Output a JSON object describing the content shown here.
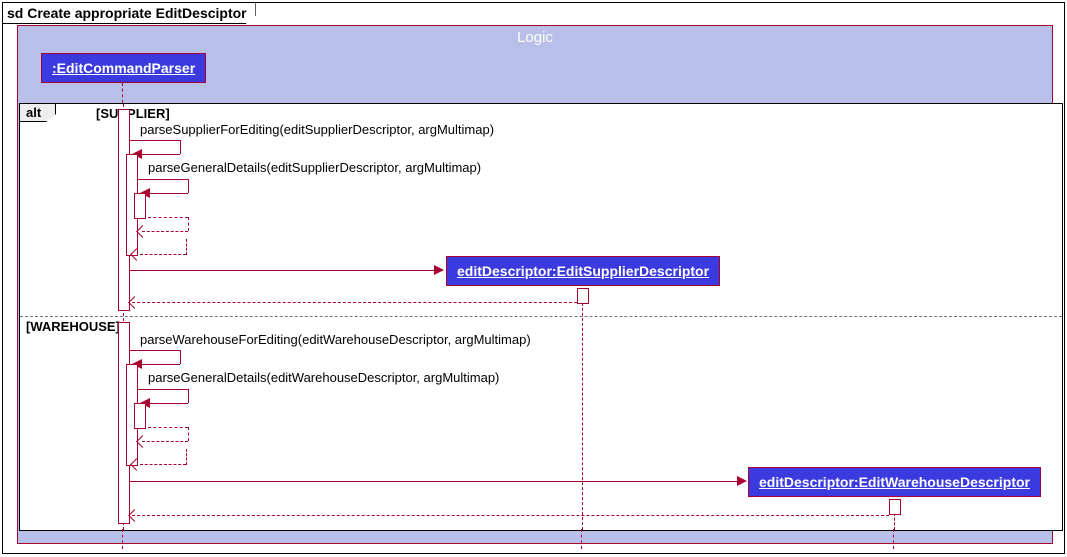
{
  "frame_title": "sd Create appropriate EditDesciptor",
  "logic_title": "Logic",
  "alt_label": "alt",
  "guard_supplier": "[SUPPLIER]",
  "guard_warehouse": "[WAREHOUSE]",
  "parser_header": ":EditCommandParser",
  "supplier_descriptor_header": "editDescriptor:EditSupplierDescriptor",
  "warehouse_descriptor_header": "editDescriptor:EditWarehouseDescriptor",
  "msg_parse_supplier": "parseSupplierForEditing(editSupplierDescriptor, argMultimap)",
  "msg_parse_general_supplier": "parseGeneralDetails(editSupplierDescriptor, argMultimap)",
  "msg_parse_warehouse": "parseWarehouseForEditing(editWarehouseDescriptor, argMultimap)",
  "msg_parse_general_warehouse": "parseGeneralDetails(editWarehouseDescriptor, argMultimap)",
  "chart_data": {
    "type": "sequence-diagram",
    "frame": "sd Create appropriate EditDesciptor",
    "container": "Logic",
    "participants": [
      {
        "id": "parser",
        "name": ":EditCommandParser"
      },
      {
        "id": "supplierDesc",
        "name": "editDescriptor:EditSupplierDescriptor",
        "created": true
      },
      {
        "id": "warehouseDesc",
        "name": "editDescriptor:EditWarehouseDescriptor",
        "created": true
      }
    ],
    "combined_fragment": {
      "operator": "alt",
      "operands": [
        {
          "guard": "[SUPPLIER]",
          "messages": [
            {
              "from": "parser",
              "to": "parser",
              "type": "self",
              "label": "parseSupplierForEditing(editSupplierDescriptor, argMultimap)"
            },
            {
              "from": "parser",
              "to": "parser",
              "type": "self",
              "label": "parseGeneralDetails(editSupplierDescriptor, argMultimap)"
            },
            {
              "from": "parser",
              "to": "parser",
              "type": "return"
            },
            {
              "from": "parser",
              "to": "parser",
              "type": "return"
            },
            {
              "from": "parser",
              "to": "supplierDesc",
              "type": "create"
            },
            {
              "from": "supplierDesc",
              "to": "parser",
              "type": "return"
            }
          ]
        },
        {
          "guard": "[WAREHOUSE]",
          "messages": [
            {
              "from": "parser",
              "to": "parser",
              "type": "self",
              "label": "parseWarehouseForEditing(editWarehouseDescriptor, argMultimap)"
            },
            {
              "from": "parser",
              "to": "parser",
              "type": "self",
              "label": "parseGeneralDetails(editWarehouseDescriptor, argMultimap)"
            },
            {
              "from": "parser",
              "to": "parser",
              "type": "return"
            },
            {
              "from": "parser",
              "to": "parser",
              "type": "return"
            },
            {
              "from": "parser",
              "to": "warehouseDesc",
              "type": "create"
            },
            {
              "from": "warehouseDesc",
              "to": "parser",
              "type": "return"
            }
          ]
        }
      ]
    }
  }
}
